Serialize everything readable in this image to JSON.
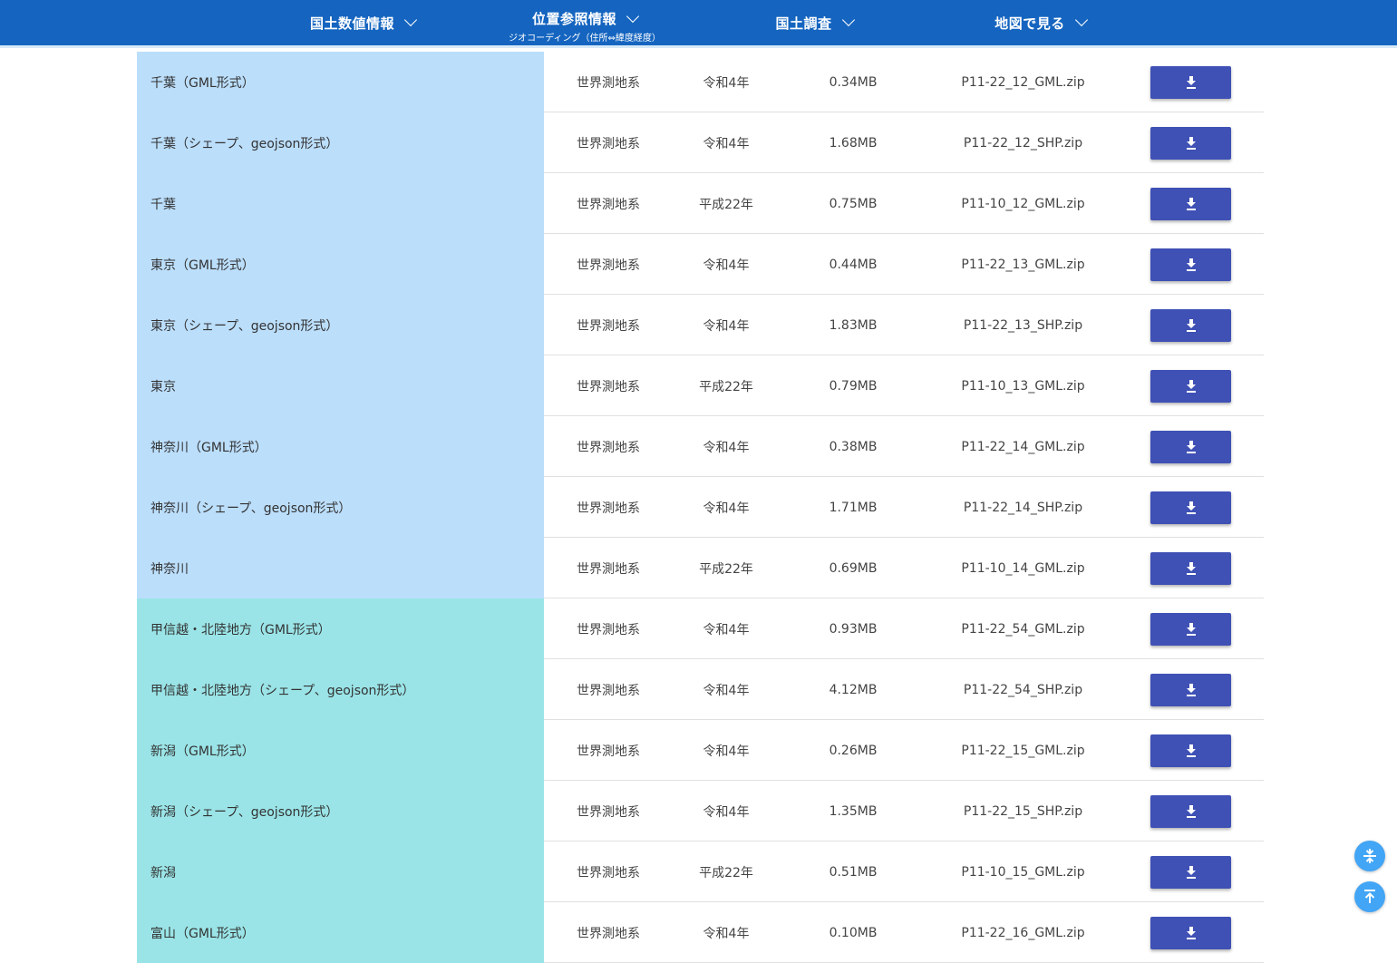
{
  "nav": {
    "items": [
      {
        "label": "国土数値情報",
        "sub": ""
      },
      {
        "label": "位置参照情報",
        "sub": "ジオコーディング（住所⇔緯度経度）"
      },
      {
        "label": "国土調査",
        "sub": ""
      },
      {
        "label": "地図で見る",
        "sub": ""
      }
    ]
  },
  "table": {
    "rows": [
      {
        "name": "千葉（GML形式）",
        "geodetic": "世界測地系",
        "year": "令和4年",
        "size": "0.34MB",
        "file": "P11-22_12_GML.zip",
        "group": "blue"
      },
      {
        "name": "千葉（シェープ、geojson形式）",
        "geodetic": "世界測地系",
        "year": "令和4年",
        "size": "1.68MB",
        "file": "P11-22_12_SHP.zip",
        "group": "blue"
      },
      {
        "name": "千葉",
        "geodetic": "世界測地系",
        "year": "平成22年",
        "size": "0.75MB",
        "file": "P11-10_12_GML.zip",
        "group": "blue"
      },
      {
        "name": "東京（GML形式）",
        "geodetic": "世界測地系",
        "year": "令和4年",
        "size": "0.44MB",
        "file": "P11-22_13_GML.zip",
        "group": "blue"
      },
      {
        "name": "東京（シェープ、geojson形式）",
        "geodetic": "世界測地系",
        "year": "令和4年",
        "size": "1.83MB",
        "file": "P11-22_13_SHP.zip",
        "group": "blue"
      },
      {
        "name": "東京",
        "geodetic": "世界測地系",
        "year": "平成22年",
        "size": "0.79MB",
        "file": "P11-10_13_GML.zip",
        "group": "blue"
      },
      {
        "name": "神奈川（GML形式）",
        "geodetic": "世界測地系",
        "year": "令和4年",
        "size": "0.38MB",
        "file": "P11-22_14_GML.zip",
        "group": "blue"
      },
      {
        "name": "神奈川（シェープ、geojson形式）",
        "geodetic": "世界測地系",
        "year": "令和4年",
        "size": "1.71MB",
        "file": "P11-22_14_SHP.zip",
        "group": "blue"
      },
      {
        "name": "神奈川",
        "geodetic": "世界測地系",
        "year": "平成22年",
        "size": "0.69MB",
        "file": "P11-10_14_GML.zip",
        "group": "blue"
      },
      {
        "name": "甲信越・北陸地方（GML形式）",
        "geodetic": "世界測地系",
        "year": "令和4年",
        "size": "0.93MB",
        "file": "P11-22_54_GML.zip",
        "group": "teal"
      },
      {
        "name": "甲信越・北陸地方（シェープ、geojson形式）",
        "geodetic": "世界測地系",
        "year": "令和4年",
        "size": "4.12MB",
        "file": "P11-22_54_SHP.zip",
        "group": "teal"
      },
      {
        "name": "新潟（GML形式）",
        "geodetic": "世界測地系",
        "year": "令和4年",
        "size": "0.26MB",
        "file": "P11-22_15_GML.zip",
        "group": "teal"
      },
      {
        "name": "新潟（シェープ、geojson形式）",
        "geodetic": "世界測地系",
        "year": "令和4年",
        "size": "1.35MB",
        "file": "P11-22_15_SHP.zip",
        "group": "teal"
      },
      {
        "name": "新潟",
        "geodetic": "世界測地系",
        "year": "平成22年",
        "size": "0.51MB",
        "file": "P11-10_15_GML.zip",
        "group": "teal"
      },
      {
        "name": "富山（GML形式）",
        "geodetic": "世界測地系",
        "year": "令和4年",
        "size": "0.10MB",
        "file": "P11-22_16_GML.zip",
        "group": "teal"
      }
    ]
  },
  "icons": {
    "download": "download-icon",
    "collapse": "collapse-icon",
    "scroll_top": "scroll-to-top-icon"
  },
  "colors": {
    "header": "#1565c0",
    "blue_group": "#bbdefb",
    "teal_group": "#9ae4e7",
    "button": "#3f51b5",
    "fab": "#42a5f5"
  }
}
